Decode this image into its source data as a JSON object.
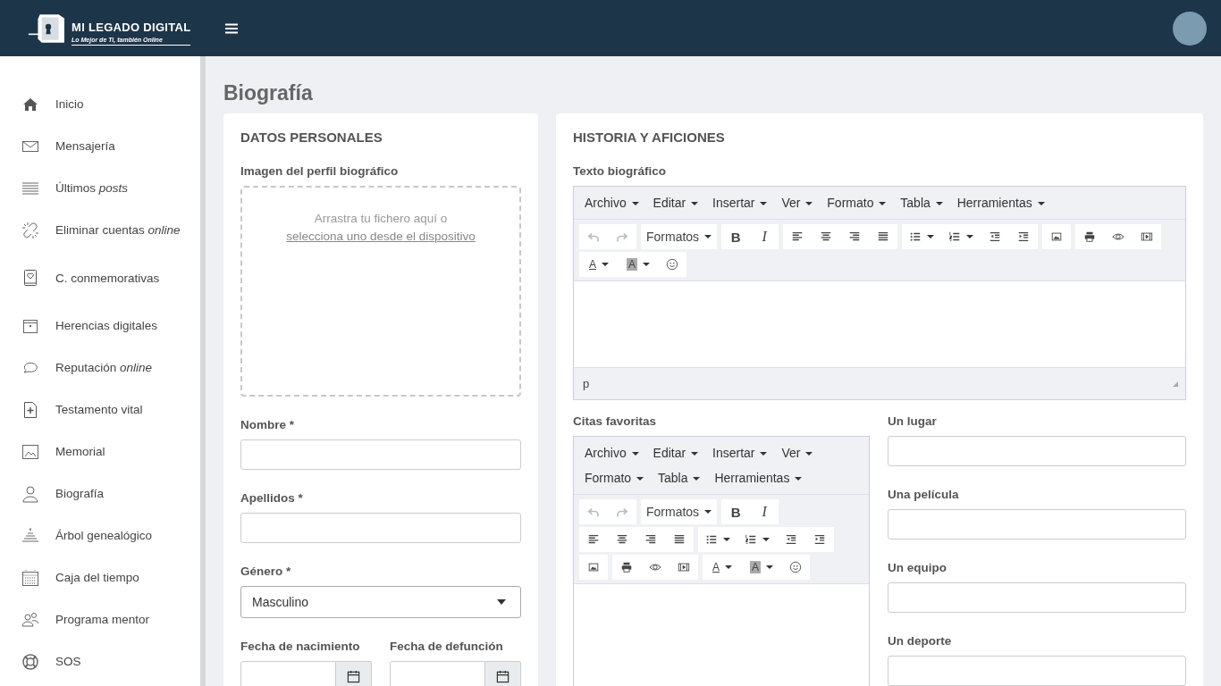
{
  "header": {
    "brand": "MI LEGADO DIGITAL",
    "tagline": "Lo Mejor de Ti, también Online"
  },
  "sidebar": {
    "items": [
      {
        "kind": "home",
        "label": "Inicio"
      },
      {
        "kind": "mail",
        "label": "Mensajería"
      },
      {
        "kind": "lines",
        "label": "Últimos *posts*"
      },
      {
        "kind": "broken-link",
        "label": "Eliminar cuentas *online*"
      },
      {
        "kind": "book",
        "label": "C. conmemorativas"
      },
      {
        "kind": "box",
        "label": "Herencias digitales"
      },
      {
        "kind": "chat",
        "label": "Reputación *online*"
      },
      {
        "kind": "file-plus",
        "label": "Testamento vital"
      },
      {
        "kind": "picture",
        "label": "Memorial"
      },
      {
        "kind": "user",
        "label": "Biografía"
      },
      {
        "kind": "stack",
        "label": "Árbol genealógico"
      },
      {
        "kind": "calendar",
        "label": "Caja del tiempo"
      },
      {
        "kind": "users",
        "label": "Programa mentor"
      },
      {
        "kind": "lifebuoy",
        "label": "SOS"
      }
    ]
  },
  "page_title": "Biografía",
  "personal": {
    "title": "DATOS PERSONALES",
    "image_label": "Imagen del perfil biográfico",
    "dropzone_text": "Arrastra tu fichero aquí o",
    "dropzone_link": "selecciona uno desde el dispositivo",
    "fields": [
      {
        "label": "Nombre *"
      },
      {
        "label": "Apellidos *"
      }
    ],
    "gender": {
      "label": "Género *",
      "value": "Masculino"
    },
    "dates": [
      {
        "label": "Fecha de nacimiento"
      },
      {
        "label": "Fecha de defunción"
      }
    ]
  },
  "history": {
    "title": "HISTORIA Y AFICIONES",
    "editors": [
      {
        "label": "Texto biográfico",
        "menus": [
          "Archivo",
          "Editar",
          "Insertar",
          "Ver",
          "Formato",
          "Tabla",
          "Herramientas"
        ],
        "status": "p",
        "toolbar": [
          [
            {
              "kind": "undo",
              "disabled": true
            },
            {
              "kind": "redo",
              "disabled": true
            }
          ],
          [
            {
              "kind": "formats",
              "label": "Formatos",
              "disabled": false
            }
          ],
          [
            {
              "kind": "bold",
              "label": "B",
              "disabled": false
            },
            {
              "kind": "italic",
              "label": "I",
              "disabled": false
            }
          ],
          [
            {
              "kind": "align-left",
              "disabled": false
            },
            {
              "kind": "align-center",
              "disabled": false
            },
            {
              "kind": "align-right",
              "disabled": false
            },
            {
              "kind": "justify",
              "disabled": false
            }
          ],
          [
            {
              "kind": "bullist",
              "disabled": false
            },
            {
              "kind": "numlist",
              "disabled": false
            },
            {
              "kind": "outdent",
              "disabled": false
            },
            {
              "kind": "indent",
              "disabled": false
            }
          ],
          [
            {
              "kind": "image",
              "disabled": false
            }
          ],
          [
            {
              "kind": "print",
              "disabled": false
            },
            {
              "kind": "preview",
              "disabled": false
            },
            {
              "kind": "media",
              "disabled": false
            }
          ],
          [
            {
              "kind": "forecolor",
              "label": "A",
              "disabled": false
            },
            {
              "kind": "backcolor",
              "label": "A",
              "disabled": false
            },
            {
              "kind": "emoticons",
              "disabled": false
            }
          ]
        ]
      },
      {
        "label": "Citas favoritas",
        "menus": [
          "Archivo",
          "Editar",
          "Insertar",
          "Ver",
          "Formato",
          "Tabla",
          "Herramientas"
        ],
        "toolbar": [
          [
            {
              "kind": "undo",
              "disabled": true
            },
            {
              "kind": "redo",
              "disabled": true
            }
          ],
          [
            {
              "kind": "formats",
              "label": "Formatos",
              "disabled": false
            }
          ],
          [
            {
              "kind": "bold",
              "label": "B",
              "disabled": false
            },
            {
              "kind": "italic",
              "label": "I",
              "disabled": false
            }
          ],
          [
            {
              "kind": "align-left",
              "disabled": false
            },
            {
              "kind": "align-center",
              "disabled": false
            },
            {
              "kind": "align-right",
              "disabled": false
            },
            {
              "kind": "justify",
              "disabled": false
            }
          ],
          [
            {
              "kind": "bullist",
              "disabled": false
            },
            {
              "kind": "numlist",
              "disabled": false
            },
            {
              "kind": "outdent",
              "disabled": false
            },
            {
              "kind": "indent",
              "disabled": false
            }
          ],
          [
            {
              "kind": "image",
              "disabled": false
            }
          ],
          [
            {
              "kind": "print",
              "disabled": false
            },
            {
              "kind": "preview",
              "disabled": false
            },
            {
              "kind": "media",
              "disabled": false
            }
          ],
          [
            {
              "kind": "forecolor",
              "label": "A",
              "disabled": false
            },
            {
              "kind": "backcolor",
              "label": "A",
              "disabled": false
            },
            {
              "kind": "emoticons",
              "disabled": false
            }
          ]
        ]
      }
    ],
    "fields": [
      {
        "label": "Un lugar"
      },
      {
        "label": "Una película"
      },
      {
        "label": "Un equipo"
      },
      {
        "label": "Un deporte"
      }
    ]
  }
}
